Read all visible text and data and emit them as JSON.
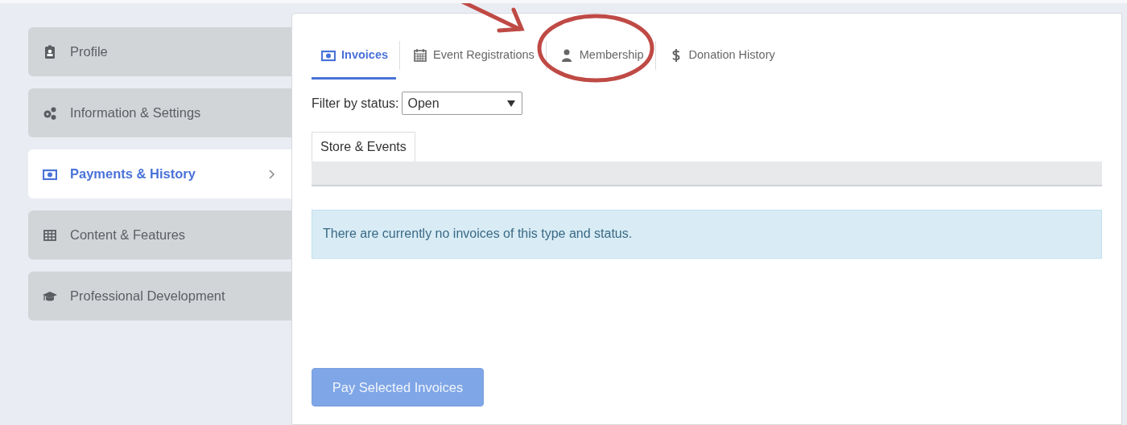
{
  "sidebar": {
    "items": [
      {
        "label": "Profile",
        "selected": false
      },
      {
        "label": "Information & Settings",
        "selected": false
      },
      {
        "label": "Payments & History",
        "selected": true
      },
      {
        "label": "Content & Features",
        "selected": false
      },
      {
        "label": "Professional Development",
        "selected": false
      }
    ]
  },
  "tabs": [
    {
      "label": "Invoices",
      "selected": true
    },
    {
      "label": "Event Registrations",
      "selected": false
    },
    {
      "label": "Membership",
      "selected": false
    },
    {
      "label": "Donation History",
      "selected": false
    }
  ],
  "filter": {
    "label": "Filter by status:",
    "value": "Open"
  },
  "subtabs": [
    {
      "label": "Store & Events",
      "selected": true
    }
  ],
  "alert": "There are currently no invoices of this type and status.",
  "pay_button": {
    "label": "Pay Selected Invoices",
    "disabled": true
  }
}
